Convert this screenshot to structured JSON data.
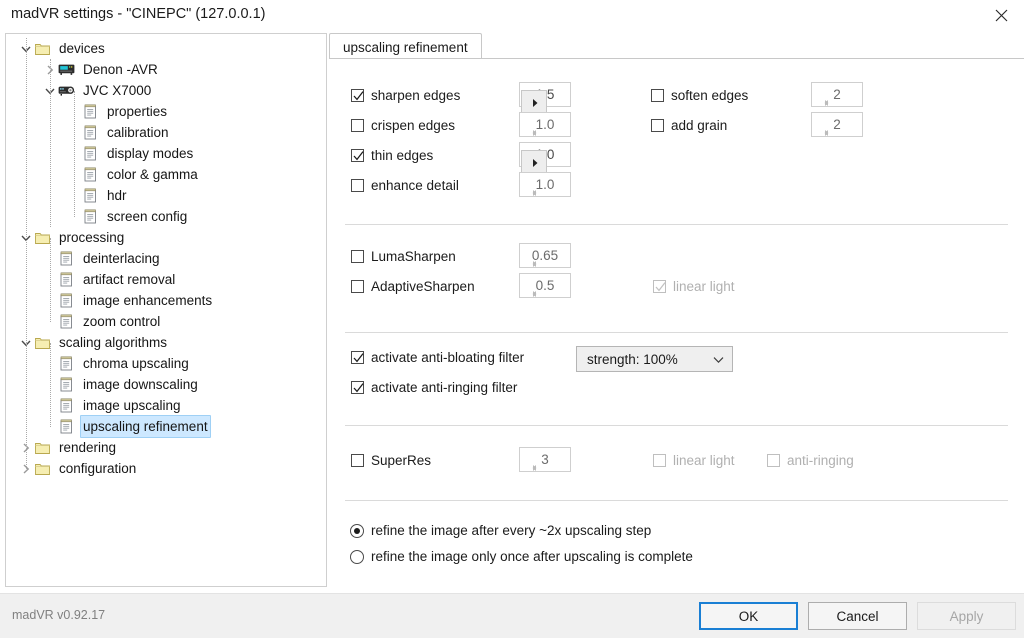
{
  "window": {
    "title": "madVR settings - \"CINEPC\" (127.0.0.1)",
    "close_icon": "close-icon",
    "version": "madVR v0.92.17"
  },
  "tree": {
    "nodes": [
      {
        "label": "devices",
        "depth": 0,
        "icon": "folder-icon",
        "expander": "expanded",
        "selected": false
      },
      {
        "label": "Denon -AVR",
        "depth": 1,
        "icon": "receiver-icon",
        "expander": "collapsed",
        "selected": false
      },
      {
        "label": "JVC X7000",
        "depth": 1,
        "icon": "projector-icon",
        "expander": "expanded",
        "selected": false
      },
      {
        "label": "properties",
        "depth": 2,
        "icon": "page-icon",
        "expander": "none",
        "selected": false
      },
      {
        "label": "calibration",
        "depth": 2,
        "icon": "page-icon",
        "expander": "none",
        "selected": false
      },
      {
        "label": "display modes",
        "depth": 2,
        "icon": "page-icon",
        "expander": "none",
        "selected": false
      },
      {
        "label": "color & gamma",
        "depth": 2,
        "icon": "page-icon",
        "expander": "none",
        "selected": false
      },
      {
        "label": "hdr",
        "depth": 2,
        "icon": "page-icon",
        "expander": "none",
        "selected": false
      },
      {
        "label": "screen config",
        "depth": 2,
        "icon": "page-icon",
        "expander": "none",
        "selected": false
      },
      {
        "label": "processing",
        "depth": 0,
        "icon": "folder-icon",
        "expander": "expanded",
        "selected": false
      },
      {
        "label": "deinterlacing",
        "depth": 1,
        "icon": "page-icon",
        "expander": "none",
        "selected": false
      },
      {
        "label": "artifact removal",
        "depth": 1,
        "icon": "page-icon",
        "expander": "none",
        "selected": false
      },
      {
        "label": "image enhancements",
        "depth": 1,
        "icon": "page-icon",
        "expander": "none",
        "selected": false
      },
      {
        "label": "zoom control",
        "depth": 1,
        "icon": "page-icon",
        "expander": "none",
        "selected": false
      },
      {
        "label": "scaling algorithms",
        "depth": 0,
        "icon": "folder-icon",
        "expander": "expanded",
        "selected": false
      },
      {
        "label": "chroma upscaling",
        "depth": 1,
        "icon": "page-icon",
        "expander": "none",
        "selected": false
      },
      {
        "label": "image downscaling",
        "depth": 1,
        "icon": "page-icon",
        "expander": "none",
        "selected": false
      },
      {
        "label": "image upscaling",
        "depth": 1,
        "icon": "page-icon",
        "expander": "none",
        "selected": false
      },
      {
        "label": "upscaling refinement",
        "depth": 1,
        "icon": "page-icon",
        "expander": "none",
        "selected": true
      },
      {
        "label": "rendering",
        "depth": 0,
        "icon": "folder-icon",
        "expander": "collapsed",
        "selected": false
      },
      {
        "label": "configuration",
        "depth": 0,
        "icon": "folder-icon",
        "expander": "collapsed",
        "selected": false
      }
    ]
  },
  "tab": {
    "label": "upscaling refinement",
    "active": true
  },
  "panel": {
    "group_edges": {
      "left_items": [
        {
          "label": "sharpen edges",
          "checked": true,
          "enabled": true,
          "value": "1.5"
        },
        {
          "label": "crispen edges",
          "checked": false,
          "enabled": false,
          "value": "1.0"
        },
        {
          "label": "thin edges",
          "checked": true,
          "enabled": true,
          "value": "1.0"
        },
        {
          "label": "enhance detail",
          "checked": false,
          "enabled": false,
          "value": "1.0"
        }
      ],
      "right_items": [
        {
          "label": "soften edges",
          "checked": false,
          "enabled": false,
          "value": "2"
        },
        {
          "label": "add grain",
          "checked": false,
          "enabled": false,
          "value": "2"
        }
      ]
    },
    "group_sharpen": {
      "items": [
        {
          "label": "LumaSharpen",
          "checked": false,
          "enabled": false,
          "value": "0.65"
        },
        {
          "label": "AdaptiveSharpen",
          "checked": false,
          "enabled": false,
          "value": "0.5"
        }
      ],
      "linear_light": {
        "label": "linear light",
        "checked": true,
        "enabled": false
      }
    },
    "group_filters": {
      "anti_bloating": {
        "label": "activate anti-bloating filter",
        "checked": true
      },
      "anti_ringing": {
        "label": "activate anti-ringing filter",
        "checked": true
      },
      "strength_select": {
        "value": "strength: 100%",
        "chevron": "chevron-down-icon"
      }
    },
    "group_superres": {
      "superres": {
        "label": "SuperRes",
        "checked": false,
        "value": "3",
        "enabled": false
      },
      "linear_light": {
        "label": "linear light",
        "checked": false,
        "enabled": false
      },
      "anti_ringing": {
        "label": "anti-ringing",
        "checked": false,
        "enabled": false
      }
    },
    "group_mode": {
      "options": [
        {
          "label": "refine the image after every ~2x upscaling step",
          "selected": true
        },
        {
          "label": "refine the image only once after upscaling is complete",
          "selected": false
        }
      ]
    }
  },
  "footer": {
    "ok": "OK",
    "cancel": "Cancel",
    "apply": "Apply",
    "apply_enabled": false
  },
  "colors": {
    "selection": "#cde8ff",
    "focus_border": "#1a7fd4",
    "folder": "#f3e6a8",
    "panel_bg": "#f0f0f0"
  }
}
